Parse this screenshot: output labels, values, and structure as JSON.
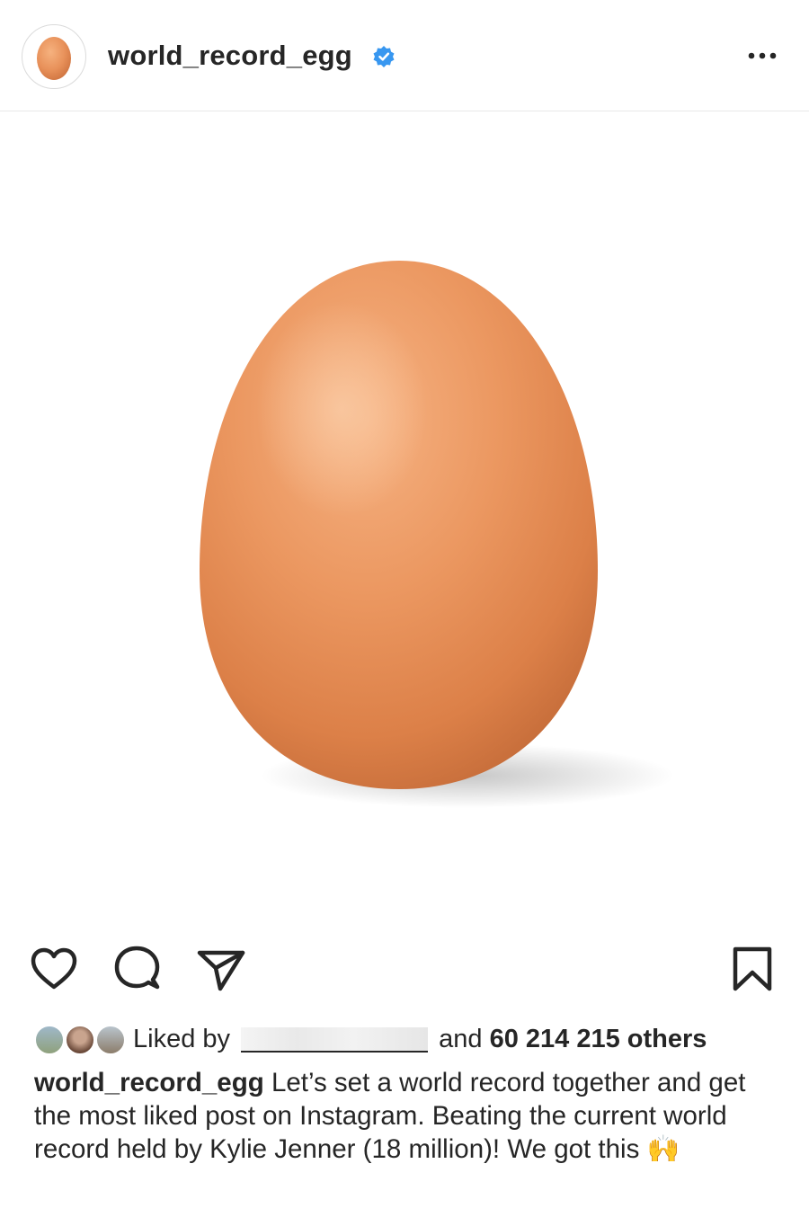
{
  "post": {
    "username": "world_record_egg",
    "verified_icon": "verified-badge-icon",
    "more_icon": "more-options-icon"
  },
  "actions": {
    "like_icon": "heart-icon",
    "comment_icon": "comment-icon",
    "share_icon": "send-icon",
    "save_icon": "bookmark-icon"
  },
  "likes": {
    "prefix": "Liked by",
    "connector": "and",
    "count_text": "60 214 215 others"
  },
  "caption": {
    "username": "world_record_egg",
    "text": "Let’s set a world record together and get the most liked post on Instagram. Beating the current world record held by Kylie Jenner (18 million)! We got this",
    "emoji": "🙌"
  },
  "colors": {
    "verified": "#3897f0",
    "egg": "#e9935f",
    "text": "#262626"
  }
}
